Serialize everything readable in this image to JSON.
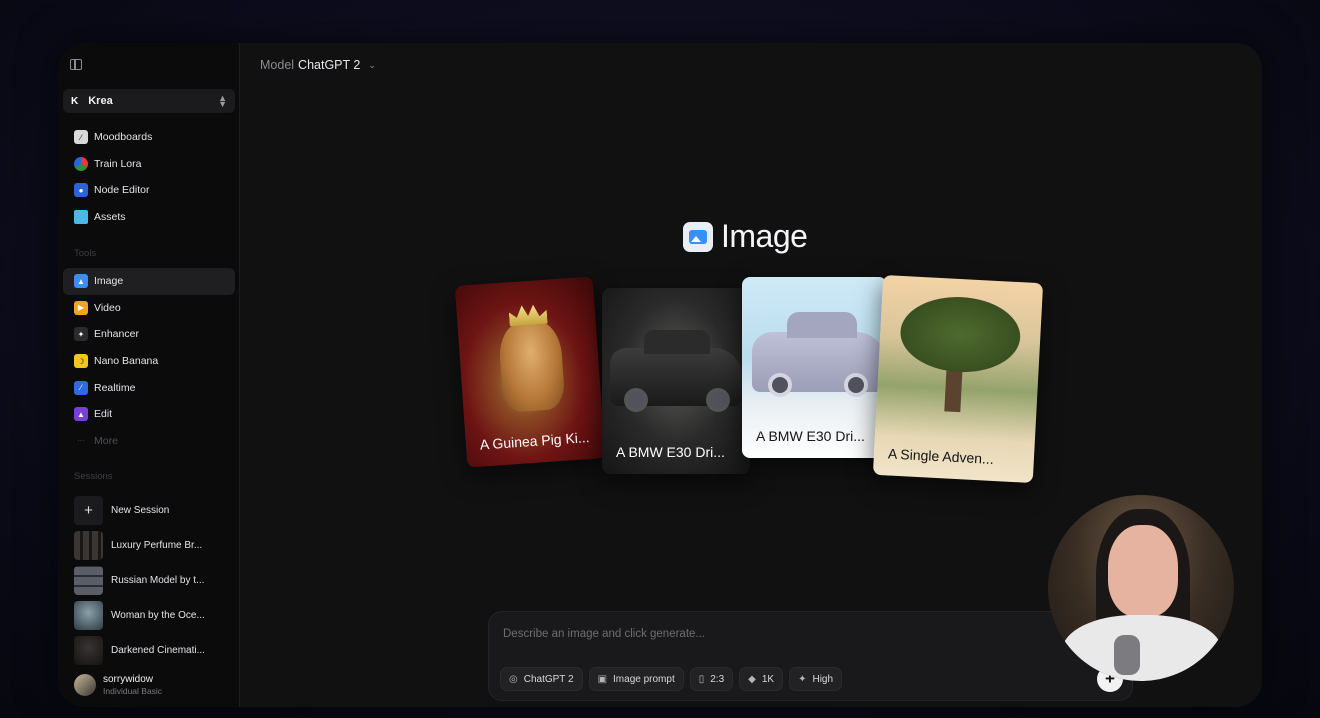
{
  "sidebar": {
    "workspace": {
      "logo": "K",
      "name": "Krea"
    },
    "top_items": [
      {
        "label": "Moodboards",
        "icon": "moodboard-icon",
        "color": "#d9d9d9"
      },
      {
        "label": "Train Lora",
        "icon": "train-lora-icon",
        "color": "#2f8f3a"
      },
      {
        "label": "Node Editor",
        "icon": "node-editor-icon",
        "color": "#2b63d9"
      },
      {
        "label": "Assets",
        "icon": "folder-icon",
        "color": "#4fb6e8"
      }
    ],
    "tools_label": "Tools",
    "tools": [
      {
        "label": "Image",
        "icon": "image-icon",
        "color": "#3b8ef2",
        "active": true
      },
      {
        "label": "Video",
        "icon": "video-icon",
        "color": "#f0a41f"
      },
      {
        "label": "Enhancer",
        "icon": "enhancer-icon",
        "color": "#2b2b2e"
      },
      {
        "label": "Nano Banana",
        "icon": "banana-icon",
        "color": "#f2c522"
      },
      {
        "label": "Realtime",
        "icon": "realtime-icon",
        "color": "#2f6be0"
      },
      {
        "label": "Edit",
        "icon": "edit-icon",
        "color": "#7a3fd6"
      },
      {
        "label": "More",
        "icon": "more-icon",
        "color": "#2b2b2e"
      }
    ],
    "sessions_label": "Sessions",
    "new_session": "New Session",
    "sessions": [
      {
        "label": "Luxury Perfume Br...",
        "color": "#2a2622"
      },
      {
        "label": "Russian Model by t...",
        "color": "#4a4e55"
      },
      {
        "label": "Woman by the Oce...",
        "color": "#3b4b55"
      },
      {
        "label": "Darkened Cinemati...",
        "color": "#1a1818"
      }
    ],
    "profile": {
      "name": "sorrywidow",
      "plan": "Individual Basic"
    }
  },
  "header": {
    "model_prefix": "Model",
    "model_value": "ChatGPT 2"
  },
  "hero": {
    "title": "Image"
  },
  "examples": [
    {
      "caption": "A Guinea Pig Ki..."
    },
    {
      "caption": "A BMW E30 Dri..."
    },
    {
      "caption": "A BMW E30 Dri..."
    },
    {
      "caption": "A Single Adven..."
    }
  ],
  "prompt": {
    "placeholder": "Describe an image and click generate...",
    "chips": [
      {
        "label": "ChatGPT 2",
        "icon": "model-icon"
      },
      {
        "label": "Image prompt",
        "icon": "image-prompt-icon"
      },
      {
        "label": "2:3",
        "icon": "aspect-ratio-icon"
      },
      {
        "label": "1K",
        "icon": "resolution-icon"
      },
      {
        "label": "High",
        "icon": "quality-icon"
      }
    ],
    "generate_icon": "+"
  }
}
